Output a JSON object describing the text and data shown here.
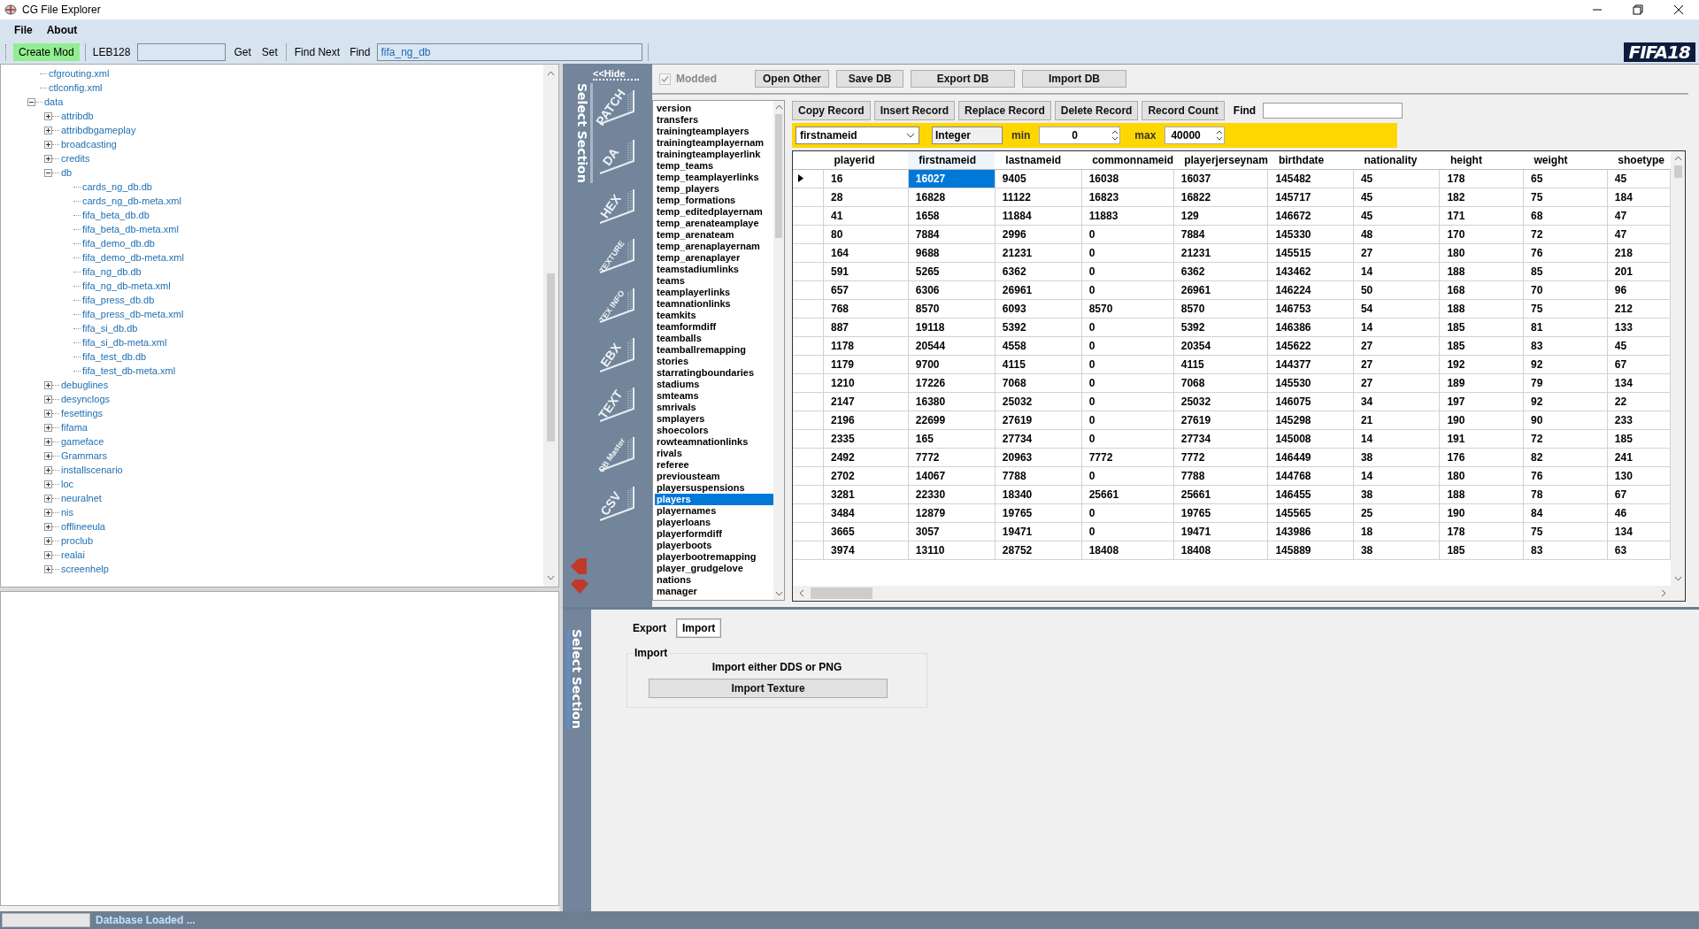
{
  "window": {
    "title": "CG File Explorer"
  },
  "menu": [
    "File",
    "About"
  ],
  "toolbar": {
    "create_mod": "Create Mod",
    "leb_label": "LEB128",
    "get": "Get",
    "set": "Set",
    "find_next": "Find Next",
    "find_label": "Find",
    "find_value": "fifa_ng_db",
    "logo": "FIFA18"
  },
  "tree": [
    {
      "label": "cfgrouting.xml",
      "kind": "file"
    },
    {
      "label": "ctlconfig.xml",
      "kind": "file"
    },
    {
      "label": "data",
      "kind": "folder",
      "expanded": true,
      "children": [
        {
          "label": "attribdb",
          "kind": "folder",
          "expanded": false
        },
        {
          "label": "attribdbgameplay",
          "kind": "folder",
          "expanded": false
        },
        {
          "label": "broadcasting",
          "kind": "folder",
          "expanded": false
        },
        {
          "label": "credits",
          "kind": "folder",
          "expanded": false
        },
        {
          "label": "db",
          "kind": "folder",
          "expanded": true,
          "children": [
            {
              "label": "cards_ng_db.db",
              "kind": "file"
            },
            {
              "label": "cards_ng_db-meta.xml",
              "kind": "file"
            },
            {
              "label": "fifa_beta_db.db",
              "kind": "file"
            },
            {
              "label": "fifa_beta_db-meta.xml",
              "kind": "file"
            },
            {
              "label": "fifa_demo_db.db",
              "kind": "file"
            },
            {
              "label": "fifa_demo_db-meta.xml",
              "kind": "file"
            },
            {
              "label": "fifa_ng_db.db",
              "kind": "file"
            },
            {
              "label": "fifa_ng_db-meta.xml",
              "kind": "file"
            },
            {
              "label": "fifa_press_db.db",
              "kind": "file"
            },
            {
              "label": "fifa_press_db-meta.xml",
              "kind": "file"
            },
            {
              "label": "fifa_si_db.db",
              "kind": "file"
            },
            {
              "label": "fifa_si_db-meta.xml",
              "kind": "file"
            },
            {
              "label": "fifa_test_db.db",
              "kind": "file"
            },
            {
              "label": "fifa_test_db-meta.xml",
              "kind": "file"
            }
          ]
        },
        {
          "label": "debuglines",
          "kind": "folder",
          "expanded": false
        },
        {
          "label": "desynclogs",
          "kind": "folder",
          "expanded": false
        },
        {
          "label": "fesettings",
          "kind": "folder",
          "expanded": false
        },
        {
          "label": "fifama",
          "kind": "folder",
          "expanded": false
        },
        {
          "label": "gameface",
          "kind": "folder",
          "expanded": false
        },
        {
          "label": "Grammars",
          "kind": "folder",
          "expanded": false
        },
        {
          "label": "installscenario",
          "kind": "folder",
          "expanded": false
        },
        {
          "label": "loc",
          "kind": "folder",
          "expanded": false
        },
        {
          "label": "neuralnet",
          "kind": "folder",
          "expanded": false
        },
        {
          "label": "nis",
          "kind": "folder",
          "expanded": false
        },
        {
          "label": "offlineeula",
          "kind": "folder",
          "expanded": false
        },
        {
          "label": "proclub",
          "kind": "folder",
          "expanded": false
        },
        {
          "label": "realai",
          "kind": "folder",
          "expanded": false
        },
        {
          "label": "screenhelp",
          "kind": "folder",
          "expanded": false
        }
      ]
    }
  ],
  "sections": {
    "hide": "<<Hide",
    "title": "Select Section",
    "items": [
      "PATCH",
      "DA",
      "HEX",
      "TEXTURE",
      "TEX INFO",
      "EBX",
      "TEXT",
      "DB Master",
      "CSV"
    ]
  },
  "db": {
    "modded": {
      "label": "Modded",
      "checked": true,
      "disabled": true
    },
    "buttons": [
      "Open Other",
      "Save DB",
      "Export DB",
      "Import DB"
    ],
    "tables": [
      {
        "name": "version",
        "selected": false
      },
      {
        "name": "transfers",
        "selected": false
      },
      {
        "name": "trainingteamplayers",
        "selected": false
      },
      {
        "name": "trainingteamplayernam",
        "selected": false
      },
      {
        "name": "trainingteamplayerlink",
        "selected": false
      },
      {
        "name": "temp_teams",
        "selected": false
      },
      {
        "name": "temp_teamplayerlinks",
        "selected": false
      },
      {
        "name": "temp_players",
        "selected": false
      },
      {
        "name": "temp_formations",
        "selected": false
      },
      {
        "name": "temp_editedplayernam",
        "selected": false
      },
      {
        "name": "temp_arenateamplaye",
        "selected": false
      },
      {
        "name": "temp_arenateam",
        "selected": false
      },
      {
        "name": "temp_arenaplayernam",
        "selected": false
      },
      {
        "name": "temp_arenaplayer",
        "selected": false
      },
      {
        "name": "teamstadiumlinks",
        "selected": false
      },
      {
        "name": "teams",
        "selected": false
      },
      {
        "name": "teamplayerlinks",
        "selected": false
      },
      {
        "name": "teamnationlinks",
        "selected": false
      },
      {
        "name": "teamkits",
        "selected": false
      },
      {
        "name": "teamformdiff",
        "selected": false
      },
      {
        "name": "teamballs",
        "selected": false
      },
      {
        "name": "teamballremapping",
        "selected": false
      },
      {
        "name": "stories",
        "selected": false
      },
      {
        "name": "starratingboundaries",
        "selected": false
      },
      {
        "name": "stadiums",
        "selected": false
      },
      {
        "name": "smteams",
        "selected": false
      },
      {
        "name": "smrivals",
        "selected": false
      },
      {
        "name": "smplayers",
        "selected": false
      },
      {
        "name": "shoecolors",
        "selected": false
      },
      {
        "name": "rowteamnationlinks",
        "selected": false
      },
      {
        "name": "rivals",
        "selected": false
      },
      {
        "name": "referee",
        "selected": false
      },
      {
        "name": "previousteam",
        "selected": false
      },
      {
        "name": "playersuspensions",
        "selected": false
      },
      {
        "name": "players",
        "selected": true
      },
      {
        "name": "playernames",
        "selected": false
      },
      {
        "name": "playerloans",
        "selected": false
      },
      {
        "name": "playerformdiff",
        "selected": false
      },
      {
        "name": "playerboots",
        "selected": false
      },
      {
        "name": "playerbootremapping",
        "selected": false
      },
      {
        "name": "player_grudgelove",
        "selected": false
      },
      {
        "name": "nations",
        "selected": false
      },
      {
        "name": "manager",
        "selected": false
      }
    ],
    "record_buttons": [
      "Copy Record",
      "Insert Record",
      "Replace Record",
      "Delete Record",
      "Record Count"
    ],
    "find_label": "Find",
    "filter": {
      "field": "firstnameid",
      "type": "Integer",
      "min_label": "min",
      "min": "0",
      "max_label": "max",
      "max": "40000"
    },
    "grid": {
      "columns": [
        {
          "label": "playerid",
          "selected": false
        },
        {
          "label": "firstnameid",
          "selected": true
        },
        {
          "label": "lastnameid",
          "selected": false
        },
        {
          "label": "commonnameid",
          "selected": false
        },
        {
          "label": "playerjerseynam",
          "selected": false
        },
        {
          "label": "birthdate",
          "selected": false
        },
        {
          "label": "nationality",
          "selected": false
        },
        {
          "label": "height",
          "selected": false
        },
        {
          "label": "weight",
          "selected": false
        },
        {
          "label": "shoetype",
          "selected": false
        }
      ],
      "rows": [
        {
          "selected": true,
          "cells": [
            "16",
            "16027",
            "9405",
            "16038",
            "16037",
            "145482",
            "45",
            "178",
            "65",
            "45"
          ]
        },
        {
          "selected": false,
          "cells": [
            "28",
            "16828",
            "11122",
            "16823",
            "16822",
            "145717",
            "45",
            "182",
            "75",
            "184"
          ]
        },
        {
          "selected": false,
          "cells": [
            "41",
            "1658",
            "11884",
            "11883",
            "129",
            "146672",
            "45",
            "171",
            "68",
            "47"
          ]
        },
        {
          "selected": false,
          "cells": [
            "80",
            "7884",
            "2996",
            "0",
            "7884",
            "145330",
            "48",
            "170",
            "72",
            "47"
          ]
        },
        {
          "selected": false,
          "cells": [
            "164",
            "9688",
            "21231",
            "0",
            "21231",
            "145515",
            "27",
            "180",
            "76",
            "218"
          ]
        },
        {
          "selected": false,
          "cells": [
            "591",
            "5265",
            "6362",
            "0",
            "6362",
            "143462",
            "14",
            "188",
            "85",
            "201"
          ]
        },
        {
          "selected": false,
          "cells": [
            "657",
            "6306",
            "26961",
            "0",
            "26961",
            "146224",
            "50",
            "168",
            "70",
            "96"
          ]
        },
        {
          "selected": false,
          "cells": [
            "768",
            "8570",
            "6093",
            "8570",
            "8570",
            "146753",
            "54",
            "188",
            "75",
            "212"
          ]
        },
        {
          "selected": false,
          "cells": [
            "887",
            "19118",
            "5392",
            "0",
            "5392",
            "146386",
            "14",
            "185",
            "81",
            "133"
          ]
        },
        {
          "selected": false,
          "cells": [
            "1178",
            "20544",
            "4558",
            "0",
            "20354",
            "145622",
            "27",
            "185",
            "83",
            "45"
          ]
        },
        {
          "selected": false,
          "cells": [
            "1179",
            "9700",
            "4115",
            "0",
            "4115",
            "144377",
            "27",
            "192",
            "92",
            "67"
          ]
        },
        {
          "selected": false,
          "cells": [
            "1210",
            "17226",
            "7068",
            "0",
            "7068",
            "145530",
            "27",
            "189",
            "79",
            "134"
          ]
        },
        {
          "selected": false,
          "cells": [
            "2147",
            "16380",
            "25032",
            "0",
            "25032",
            "146075",
            "34",
            "197",
            "92",
            "22"
          ]
        },
        {
          "selected": false,
          "cells": [
            "2196",
            "22699",
            "27619",
            "0",
            "27619",
            "145298",
            "21",
            "190",
            "90",
            "233"
          ]
        },
        {
          "selected": false,
          "cells": [
            "2335",
            "165",
            "27734",
            "0",
            "27734",
            "145008",
            "14",
            "191",
            "72",
            "185"
          ]
        },
        {
          "selected": false,
          "cells": [
            "2492",
            "7772",
            "20963",
            "7772",
            "7772",
            "146449",
            "38",
            "176",
            "82",
            "241"
          ]
        },
        {
          "selected": false,
          "cells": [
            "2702",
            "14067",
            "7788",
            "0",
            "7788",
            "144768",
            "14",
            "180",
            "76",
            "130"
          ]
        },
        {
          "selected": false,
          "cells": [
            "3281",
            "22330",
            "18340",
            "25661",
            "25661",
            "146455",
            "38",
            "188",
            "78",
            "67"
          ]
        },
        {
          "selected": false,
          "cells": [
            "3484",
            "12879",
            "19765",
            "0",
            "19765",
            "145565",
            "25",
            "190",
            "84",
            "46"
          ]
        },
        {
          "selected": false,
          "cells": [
            "3665",
            "3057",
            "19471",
            "0",
            "19471",
            "143986",
            "18",
            "178",
            "75",
            "134"
          ]
        },
        {
          "selected": false,
          "cells": [
            "3974",
            "13110",
            "28752",
            "18408",
            "18408",
            "145889",
            "38",
            "185",
            "83",
            "63"
          ]
        }
      ]
    }
  },
  "texture": {
    "section_title": "Select Section",
    "tabs": [
      {
        "label": "Export",
        "selected": false
      },
      {
        "label": "Import",
        "selected": true
      }
    ],
    "group_title": "Import",
    "hint": "Import either DDS or PNG",
    "button": "Import Texture"
  },
  "status": {
    "message": "Database Loaded ..."
  }
}
